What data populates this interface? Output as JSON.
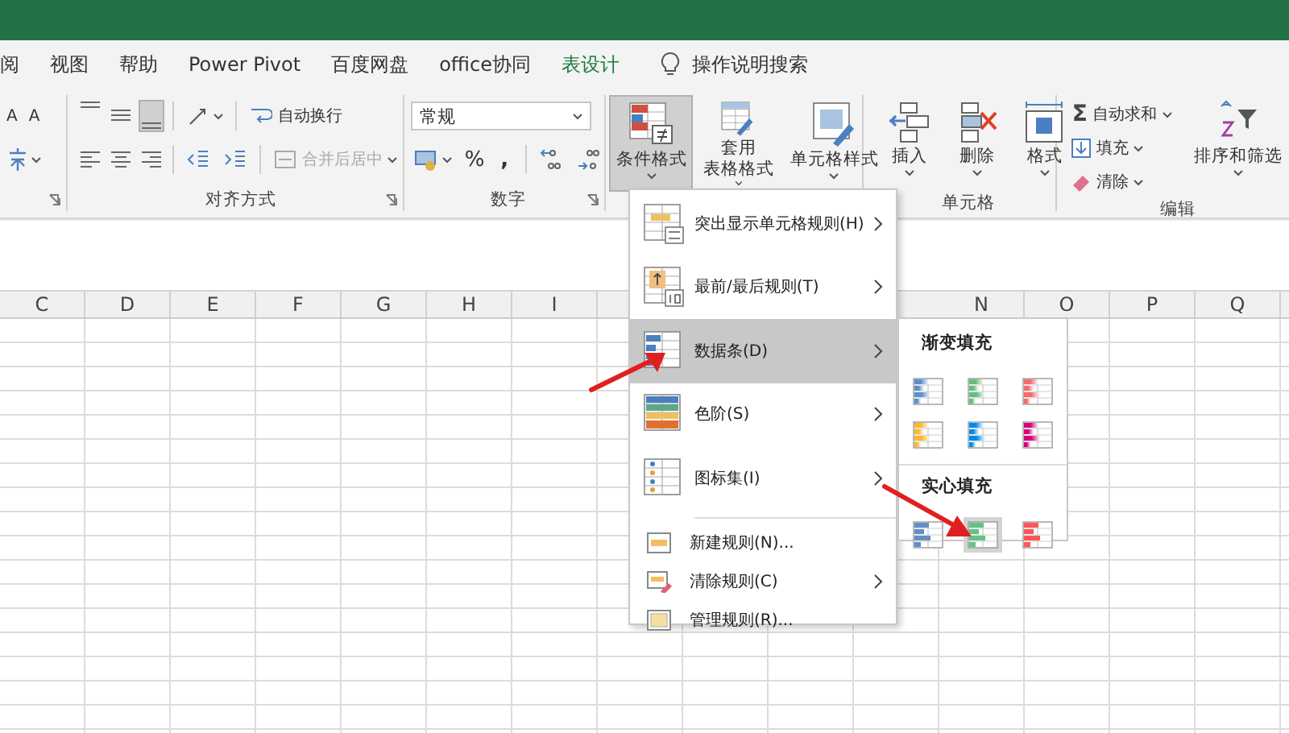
{
  "ribbon_tabs": [
    {
      "label": "阅",
      "kind": "normal",
      "selected": false
    },
    {
      "label": "视图",
      "kind": "normal",
      "selected": false
    },
    {
      "label": "帮助",
      "kind": "normal",
      "selected": false
    },
    {
      "label": "Power Pivot",
      "kind": "normal",
      "selected": false
    },
    {
      "label": "百度网盘",
      "kind": "normal",
      "selected": false
    },
    {
      "label": "office协同",
      "kind": "normal",
      "selected": false
    },
    {
      "label": "表设计",
      "kind": "contextual",
      "selected": false
    }
  ],
  "tell_me": "操作说明搜索",
  "font_group": {
    "grow_font": "A",
    "shrink_font": "A"
  },
  "alignment_group": {
    "label": "对齐方式",
    "vertical_align": [
      {
        "selected": false
      },
      {
        "selected": false
      },
      {
        "selected": true
      }
    ],
    "wrap_text": {
      "label": "自动换行",
      "disabled": false
    },
    "merge_center": {
      "label": "合并后居中",
      "disabled": true
    }
  },
  "number_group": {
    "label": "数字",
    "format": "常规",
    "percent": "%",
    "comma": ","
  },
  "styles_group": {
    "buttons": [
      {
        "lines": [
          "条件格式"
        ],
        "pressed": true
      },
      {
        "lines": [
          "套用",
          "表格格式"
        ],
        "pressed": false
      },
      {
        "lines": [
          "单元格样式"
        ],
        "pressed": false
      }
    ]
  },
  "cells_group": {
    "label": "单元格",
    "buttons": [
      "插入",
      "删除",
      "格式"
    ]
  },
  "editing_group": {
    "label": "编辑",
    "autosum_symbol": "Σ",
    "autosum": "自动求和",
    "fill": "填充",
    "clear": "清除",
    "sort_filter": "排序和筛选"
  },
  "column_headers_left": [
    "C",
    "D",
    "E",
    "F",
    "G",
    "H",
    "I"
  ],
  "column_headers_right": [
    "N",
    "O",
    "P",
    "Q"
  ],
  "conditional_menu": {
    "items": [
      {
        "label": "突出显示单元格规则(H)",
        "kind": "large",
        "has_submenu": true,
        "selected": false
      },
      {
        "label": "最前/最后规则(T)",
        "kind": "large",
        "has_submenu": true,
        "selected": false
      },
      {
        "label": "数据条(D)",
        "kind": "large",
        "has_submenu": true,
        "selected": true
      },
      {
        "label": "色阶(S)",
        "kind": "large",
        "has_submenu": true,
        "selected": false
      },
      {
        "label": "图标集(I)",
        "kind": "large",
        "has_submenu": true,
        "selected": false
      },
      {
        "label": "新建规则(N)...",
        "kind": "small",
        "has_submenu": false,
        "selected": false
      },
      {
        "label": "清除规则(C)",
        "kind": "small",
        "has_submenu": true,
        "selected": false
      },
      {
        "label": "管理规则(R)...",
        "kind": "small",
        "has_submenu": false,
        "selected": false
      }
    ],
    "submenu": {
      "sections": [
        {
          "title": "渐变填充",
          "kind": "gradient",
          "items": [
            {
              "color": "#5b8fd0",
              "selected": false
            },
            {
              "color": "#63be7b",
              "selected": false
            },
            {
              "color": "#f8696b",
              "selected": false
            },
            {
              "color": "#ffb628",
              "selected": false
            },
            {
              "color": "#008aef",
              "selected": false
            },
            {
              "color": "#d6007b",
              "selected": false
            }
          ]
        },
        {
          "title": "实心填充",
          "kind": "solid",
          "items": [
            {
              "color": "#638ec6",
              "selected": false
            },
            {
              "color": "#63c384",
              "selected": true
            },
            {
              "color": "#ff555a",
              "selected": false
            }
          ]
        }
      ]
    }
  }
}
